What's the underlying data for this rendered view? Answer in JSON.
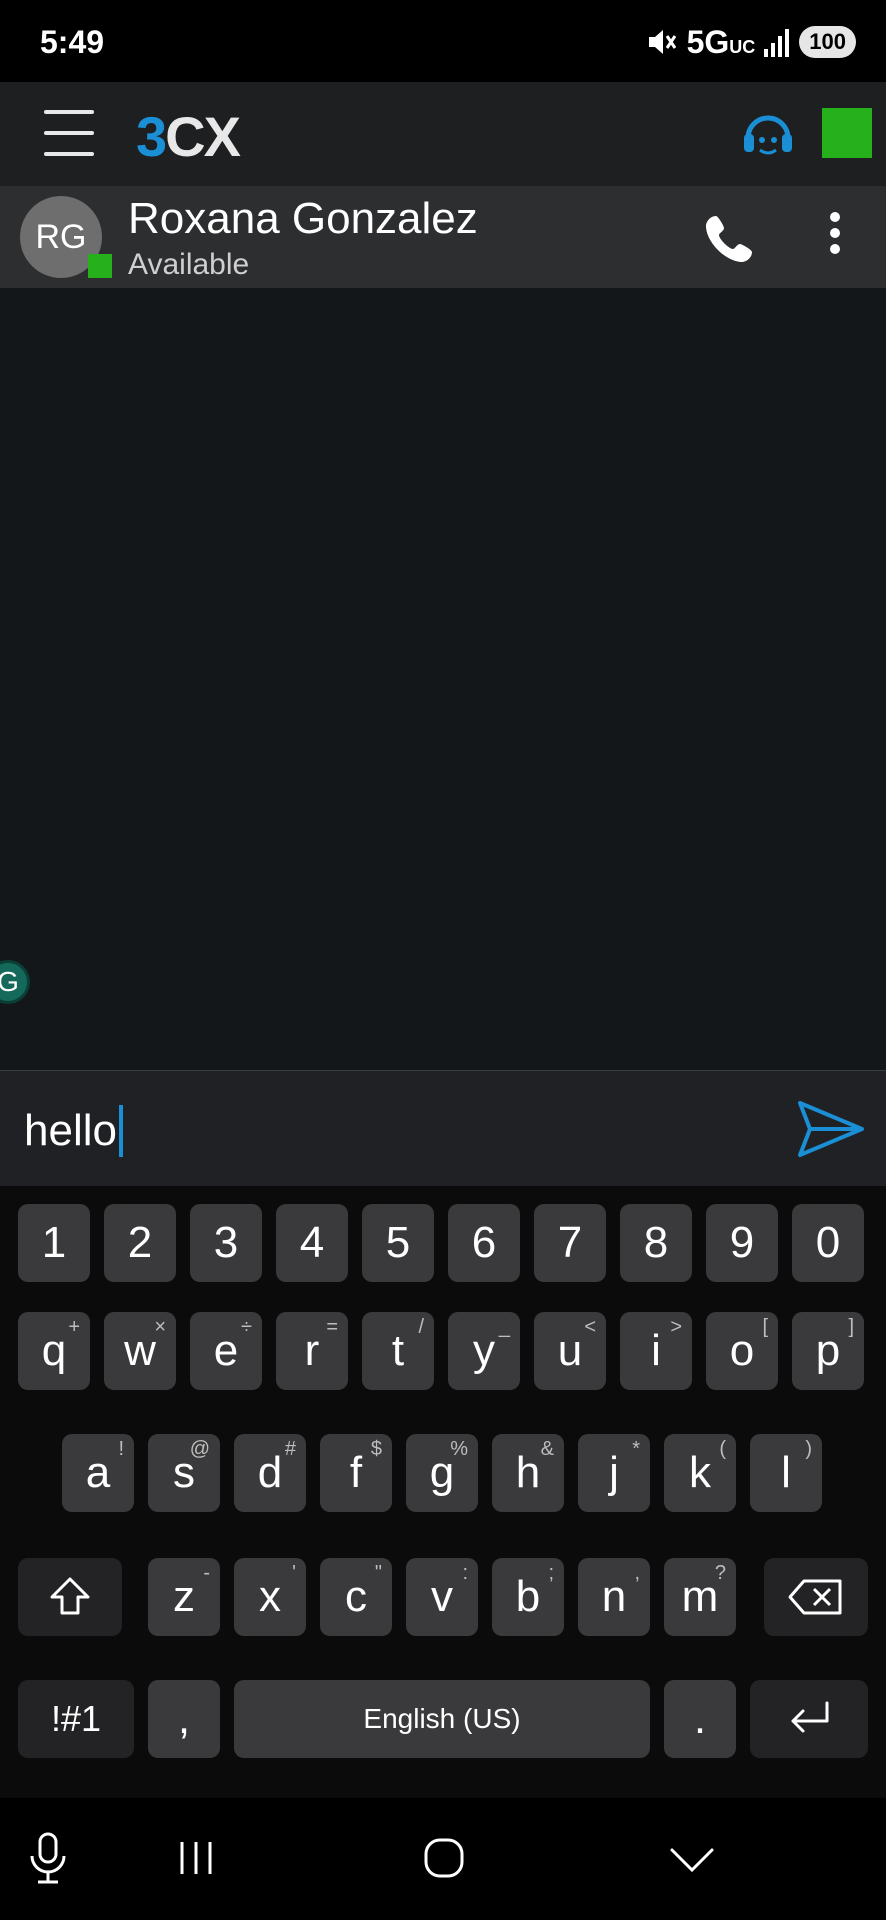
{
  "status_bar": {
    "time": "5:49",
    "network": "5G",
    "network_sub": "UC",
    "battery": "100"
  },
  "app": {
    "logo_3": "3",
    "logo_cx": "CX",
    "status_color": "#26b01c",
    "accent": "#1a8fd6"
  },
  "contact": {
    "initials": "RG",
    "name": "Roxana Gonzalez",
    "status": "Available"
  },
  "chat": {
    "grammarly_letter": "G"
  },
  "compose": {
    "text": "hello"
  },
  "keyboard": {
    "numbers": [
      "1",
      "2",
      "3",
      "4",
      "5",
      "6",
      "7",
      "8",
      "9",
      "0"
    ],
    "row1": [
      {
        "k": "q",
        "s": "+"
      },
      {
        "k": "w",
        "s": "×"
      },
      {
        "k": "e",
        "s": "÷"
      },
      {
        "k": "r",
        "s": "="
      },
      {
        "k": "t",
        "s": "/"
      },
      {
        "k": "y",
        "s": "_"
      },
      {
        "k": "u",
        "s": "<"
      },
      {
        "k": "i",
        "s": ">"
      },
      {
        "k": "o",
        "s": "["
      },
      {
        "k": "p",
        "s": "]"
      }
    ],
    "row2": [
      {
        "k": "a",
        "s": "!"
      },
      {
        "k": "s",
        "s": "@"
      },
      {
        "k": "d",
        "s": "#"
      },
      {
        "k": "f",
        "s": "$"
      },
      {
        "k": "g",
        "s": "%"
      },
      {
        "k": "h",
        "s": "&"
      },
      {
        "k": "j",
        "s": "*"
      },
      {
        "k": "k",
        "s": "("
      },
      {
        "k": "l",
        "s": ")"
      }
    ],
    "row3": [
      {
        "k": "z",
        "s": "-"
      },
      {
        "k": "x",
        "s": "'"
      },
      {
        "k": "c",
        "s": "\""
      },
      {
        "k": "v",
        "s": ":"
      },
      {
        "k": "b",
        "s": ";"
      },
      {
        "k": "n",
        "s": ","
      },
      {
        "k": "m",
        "s": "?"
      }
    ],
    "symbols_label": "!#1",
    "comma": ",",
    "space_label": "English (US)",
    "period": "."
  }
}
